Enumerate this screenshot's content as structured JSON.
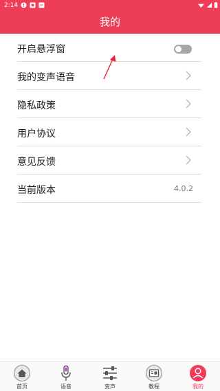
{
  "status_bar": {
    "time": "2:14"
  },
  "header": {
    "title": "我的"
  },
  "settings": [
    {
      "label": "开启悬浮窗",
      "control": "toggle",
      "toggle_on": false
    },
    {
      "label": "我的变声语音",
      "control": "chevron"
    },
    {
      "label": "隐私政策",
      "control": "chevron"
    },
    {
      "label": "用户协议",
      "control": "chevron"
    },
    {
      "label": "意见反馈",
      "control": "chevron"
    },
    {
      "label": "当前版本",
      "control": "value",
      "value": "4.0.2"
    }
  ],
  "tabs": [
    {
      "label": "首页",
      "icon": "home-icon",
      "active": false
    },
    {
      "label": "语音",
      "icon": "microphone-icon",
      "active": false
    },
    {
      "label": "变声",
      "icon": "sliders-icon",
      "active": false
    },
    {
      "label": "教程",
      "icon": "tutorial-icon",
      "active": false
    },
    {
      "label": "我的",
      "icon": "profile-icon",
      "active": true
    }
  ],
  "colors": {
    "accent": "#ee3d57",
    "annotation_arrow": "#e8233a",
    "toggle_off": "#a7a7a7"
  }
}
